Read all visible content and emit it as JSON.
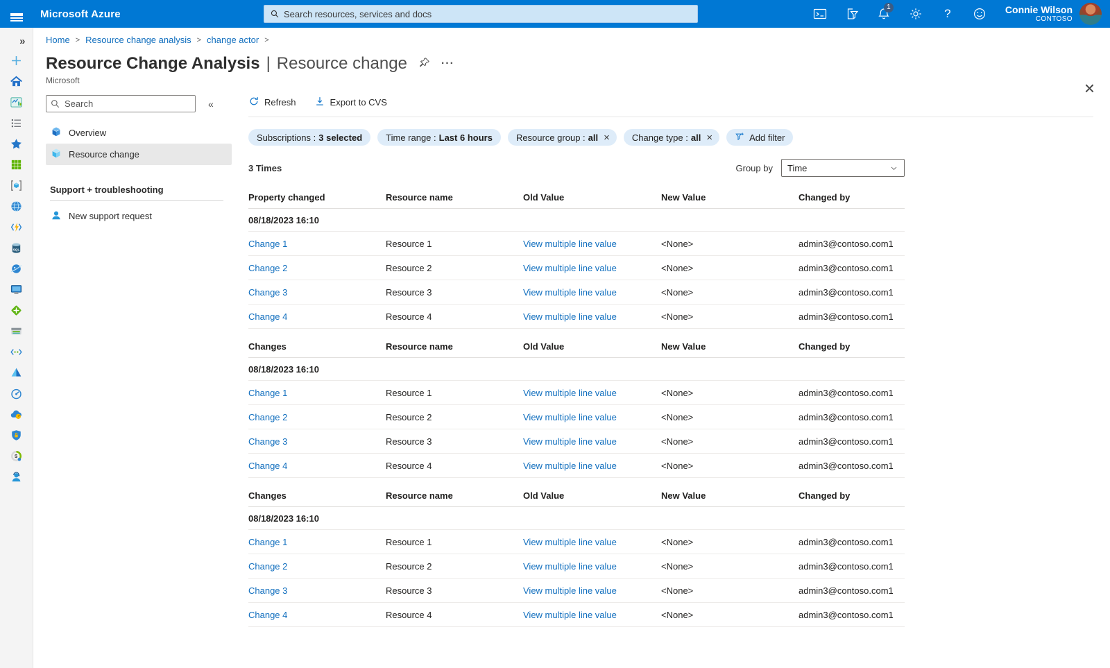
{
  "colors": {
    "brand": "#0078d4",
    "link": "#106ebe",
    "pill_bg": "#deecf9",
    "badge_bg": "#3a5c85"
  },
  "topbar": {
    "brand": "Microsoft Azure",
    "search_placeholder": "Search resources, services and docs",
    "icons": [
      "cloud-shell",
      "directory-filter",
      "notifications",
      "settings",
      "help",
      "feedback"
    ],
    "notification_badge": "1",
    "user_name": "Connie Wilson",
    "user_org": "CONTOSO"
  },
  "rail": {
    "expand_glyph": "»",
    "items": [
      "create-resource",
      "home",
      "dashboard",
      "all-services",
      "favorites",
      "all-resources",
      "resource-groups",
      "app-services",
      "function-app",
      "sql-database",
      "cosmos-db",
      "virtual-machine",
      "load-balancer",
      "storage-account",
      "virtual-network",
      "azure-ad",
      "monitor",
      "advisor",
      "security-center",
      "cost-management",
      "help-support"
    ]
  },
  "breadcrumb": {
    "items": [
      "Home",
      "Resource change analysis",
      "change actor"
    ]
  },
  "page": {
    "title_primary": "Resource Change Analysis",
    "title_separator": "|",
    "title_secondary": "Resource change",
    "publisher": "Microsoft",
    "more_glyph": "···",
    "close_glyph": "×"
  },
  "nav": {
    "search_placeholder": "Search",
    "collapse_glyph": "«",
    "items": [
      {
        "id": "overview",
        "label": "Overview",
        "selected": false
      },
      {
        "id": "resource-change",
        "label": "Resource change",
        "selected": true
      }
    ],
    "section_title": "Support + troubleshooting",
    "section_items": [
      {
        "id": "new-support-request",
        "label": "New support request"
      }
    ]
  },
  "toolbar": {
    "buttons": [
      {
        "id": "refresh",
        "label": "Refresh"
      },
      {
        "id": "export",
        "label": "Export to CVS"
      }
    ]
  },
  "filters": {
    "pills": [
      {
        "label": "Subscriptions :",
        "value": "3 selected",
        "closable": false
      },
      {
        "label": "Time range :",
        "value": "Last 6 hours",
        "closable": false
      },
      {
        "label": "Resource group :",
        "value": "all",
        "closable": true
      },
      {
        "label": "Change type :",
        "value": "all",
        "closable": true
      }
    ],
    "close_glyph": "×",
    "add_filter_label": "Add filter"
  },
  "meta": {
    "result_count": "3 Times",
    "group_by_label": "Group by",
    "group_by_value": "Time"
  },
  "table": {
    "groups": [
      {
        "headers": [
          "Property changed",
          "Resource name",
          "Old Value",
          "New Value",
          "Changed by"
        ],
        "date": "08/18/2023 16:10",
        "rows": [
          {
            "change": "Change 1",
            "resource": "Resource 1",
            "old_value": "View multiple line value",
            "new_value": "<None>",
            "changed_by": "admin3@contoso.com1"
          },
          {
            "change": "Change 2",
            "resource": "Resource 2",
            "old_value": "View multiple line value",
            "new_value": "<None>",
            "changed_by": "admin3@contoso.com1"
          },
          {
            "change": "Change 3",
            "resource": "Resource 3",
            "old_value": "View multiple line value",
            "new_value": "<None>",
            "changed_by": "admin3@contoso.com1"
          },
          {
            "change": "Change 4",
            "resource": "Resource 4",
            "old_value": "View multiple line value",
            "new_value": "<None>",
            "changed_by": "admin3@contoso.com1"
          }
        ]
      },
      {
        "headers": [
          "Changes",
          "Resource name",
          "Old Value",
          "New Value",
          "Changed by"
        ],
        "date": "08/18/2023 16:10",
        "rows": [
          {
            "change": "Change 1",
            "resource": "Resource 1",
            "old_value": "View multiple line value",
            "new_value": "<None>",
            "changed_by": "admin3@contoso.com1"
          },
          {
            "change": "Change 2",
            "resource": "Resource 2",
            "old_value": "View multiple line value",
            "new_value": "<None>",
            "changed_by": "admin3@contoso.com1"
          },
          {
            "change": "Change 3",
            "resource": "Resource 3",
            "old_value": "View multiple line value",
            "new_value": "<None>",
            "changed_by": "admin3@contoso.com1"
          },
          {
            "change": "Change 4",
            "resource": "Resource 4",
            "old_value": "View multiple line value",
            "new_value": "<None>",
            "changed_by": "admin3@contoso.com1"
          }
        ]
      },
      {
        "headers": [
          "Changes",
          "Resource name",
          "Old Value",
          "New Value",
          "Changed by"
        ],
        "date": "08/18/2023 16:10",
        "rows": [
          {
            "change": "Change 1",
            "resource": "Resource 1",
            "old_value": "View multiple line value",
            "new_value": "<None>",
            "changed_by": "admin3@contoso.com1"
          },
          {
            "change": "Change 2",
            "resource": "Resource 2",
            "old_value": "View multiple line value",
            "new_value": "<None>",
            "changed_by": "admin3@contoso.com1"
          },
          {
            "change": "Change 3",
            "resource": "Resource 3",
            "old_value": "View multiple line value",
            "new_value": "<None>",
            "changed_by": "admin3@contoso.com1"
          },
          {
            "change": "Change 4",
            "resource": "Resource 4",
            "old_value": "View multiple line value",
            "new_value": "<None>",
            "changed_by": "admin3@contoso.com1"
          }
        ]
      }
    ]
  }
}
